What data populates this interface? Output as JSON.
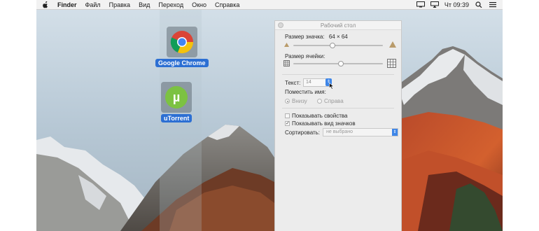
{
  "menubar": {
    "app_name": "Finder",
    "items": [
      "Файл",
      "Правка",
      "Вид",
      "Переход",
      "Окно",
      "Справка"
    ],
    "clock": "Чт 09:39",
    "icons": [
      "apple-icon",
      "display-icon",
      "airplay-icon",
      "search-icon",
      "menu-list-icon"
    ]
  },
  "desktop": {
    "icons": [
      {
        "label": "Google Chrome",
        "icon": "chrome-icon",
        "selected": true
      },
      {
        "label": "uTorrent",
        "icon": "utorrent-icon",
        "selected": true
      }
    ]
  },
  "panel": {
    "title": "Рабочий стол",
    "icon_size_label": "Размер значка:",
    "icon_size_value": "64 × 64",
    "grid_spacing_label": "Размер ячейки:",
    "text_label": "Текст:",
    "text_size_value": "14",
    "label_position_label": "Поместить имя:",
    "position_options": [
      {
        "label": "Внизу",
        "selected": true
      },
      {
        "label": "Справа",
        "selected": false
      }
    ],
    "checkboxes": [
      {
        "label": "Показывать свойства",
        "checked": false
      },
      {
        "label": "Показывать вид значков",
        "checked": true
      }
    ],
    "sort_label": "Сортировать:",
    "sort_value": "не выбрано"
  },
  "colors": {
    "selection_blue": "#2c6fd3",
    "control_blue": "#3e86e8",
    "utorrent_green": "#7cc242"
  }
}
